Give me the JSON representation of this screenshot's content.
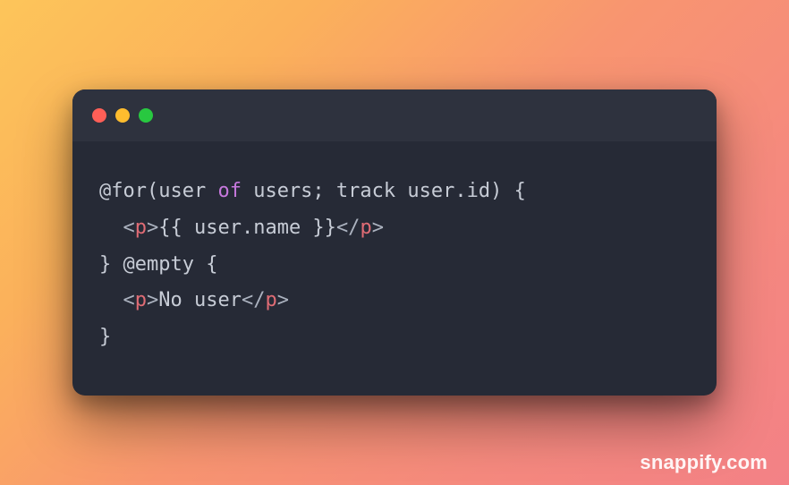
{
  "window": {
    "traffic_lights": [
      "close",
      "minimize",
      "maximize"
    ]
  },
  "code": {
    "lines": [
      [
        {
          "t": "@for(user ",
          "c": "default"
        },
        {
          "t": "of",
          "c": "keyword"
        },
        {
          "t": " users; track user.id) {",
          "c": "default"
        }
      ],
      [
        {
          "t": "  <",
          "c": "punct"
        },
        {
          "t": "p",
          "c": "tag"
        },
        {
          "t": ">",
          "c": "punct"
        },
        {
          "t": "{{ user.name }}",
          "c": "default"
        },
        {
          "t": "</",
          "c": "punct"
        },
        {
          "t": "p",
          "c": "tag"
        },
        {
          "t": ">",
          "c": "punct"
        }
      ],
      [
        {
          "t": "} @empty {",
          "c": "default"
        }
      ],
      [
        {
          "t": "  <",
          "c": "punct"
        },
        {
          "t": "p",
          "c": "tag"
        },
        {
          "t": ">",
          "c": "punct"
        },
        {
          "t": "No user",
          "c": "default"
        },
        {
          "t": "</",
          "c": "punct"
        },
        {
          "t": "p",
          "c": "tag"
        },
        {
          "t": ">",
          "c": "punct"
        }
      ],
      [
        {
          "t": "}",
          "c": "default"
        }
      ]
    ]
  },
  "watermark": "snappify.com"
}
